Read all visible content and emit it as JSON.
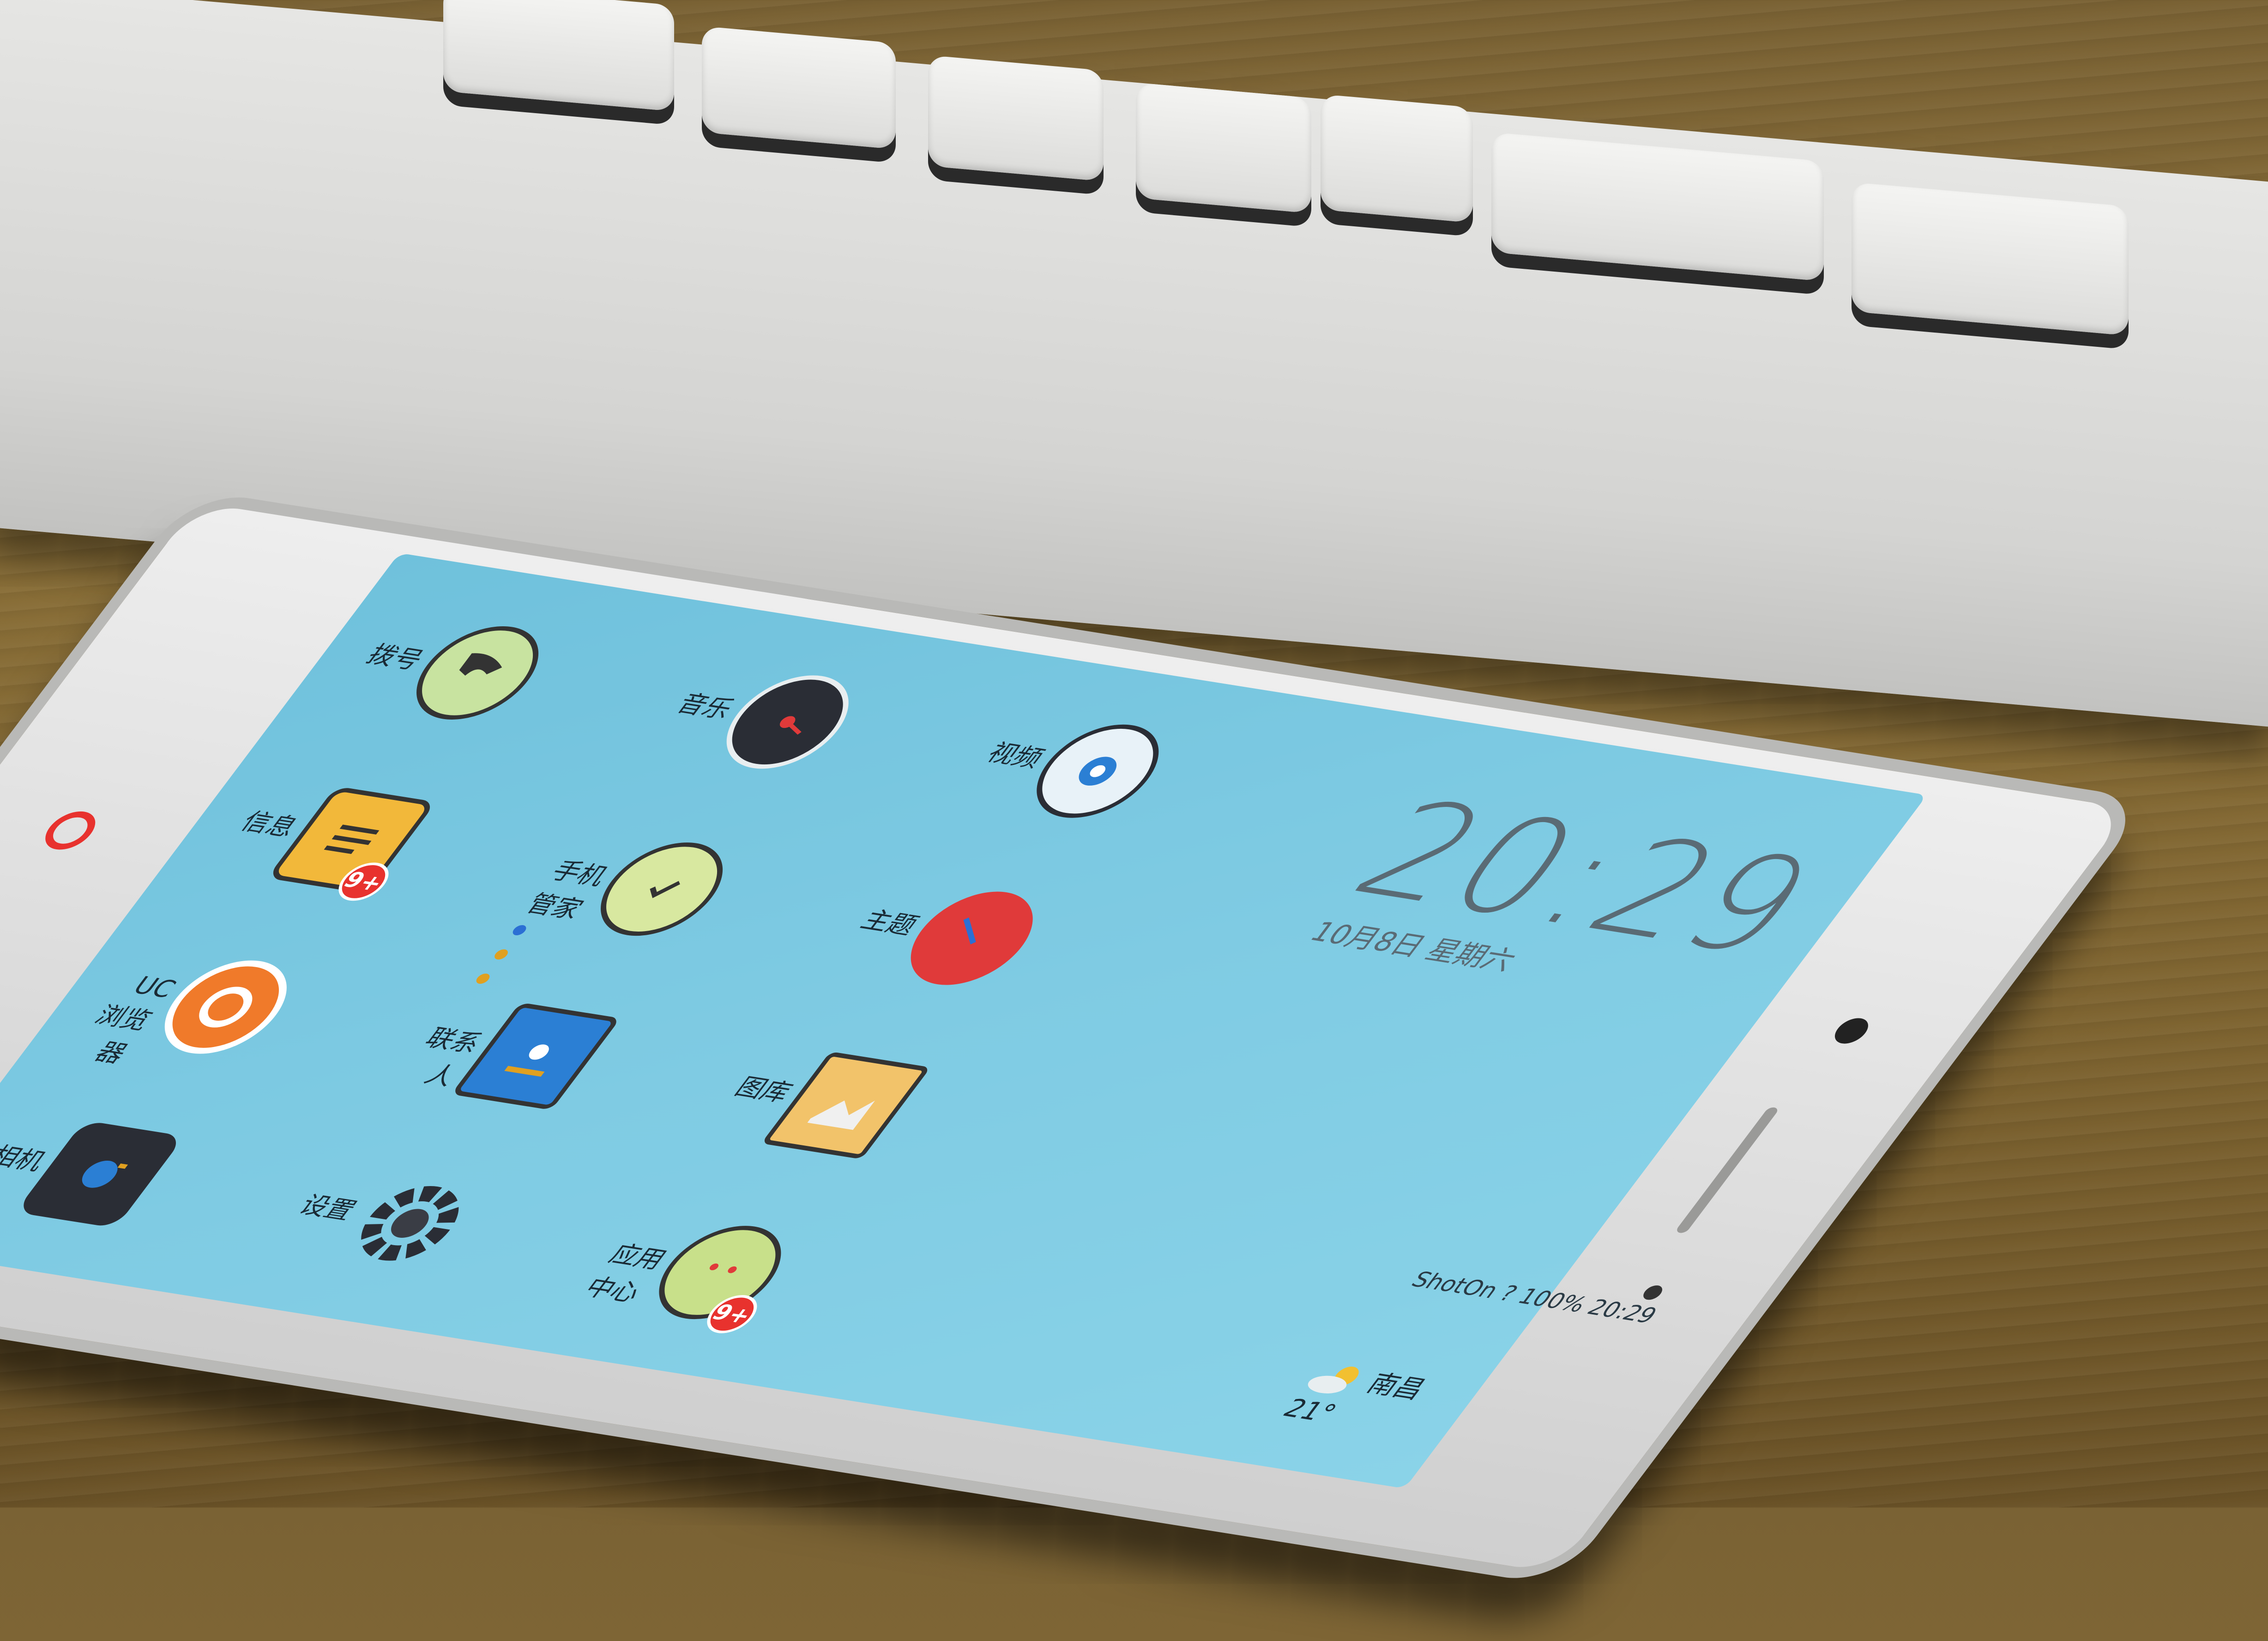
{
  "apps": [
    {
      "label": "拨号",
      "icon": "phone-dial-icon",
      "color": "#c8e3a0"
    },
    {
      "label": "音乐",
      "icon": "music-record-icon",
      "color": "#2a2d35"
    },
    {
      "label": "视频",
      "icon": "video-lens-icon",
      "color": "#e8f2f8"
    },
    {
      "label": "信息",
      "icon": "message-note-icon",
      "color": "#f2b83a",
      "badge": "9+"
    },
    {
      "label": "手机管家",
      "icon": "phone-manager-pill-icon",
      "color": "#d8e8a0"
    },
    {
      "label": "主题",
      "icon": "theme-heart-icon",
      "color": "#e03a3a"
    },
    {
      "label": "UC浏览器",
      "icon": "uc-browser-icon",
      "color": "#f07a2a"
    },
    {
      "label": "联系人",
      "icon": "contacts-book-icon",
      "color": "#2b7fd4"
    },
    {
      "label": "图库",
      "icon": "gallery-photo-icon",
      "color": "#f2c36a"
    },
    {
      "label": "相机",
      "icon": "camera-icon",
      "color": "#2a2d35"
    },
    {
      "label": "设置",
      "icon": "settings-gear-icon",
      "color": "#2a2d35"
    },
    {
      "label": "应用中心",
      "icon": "app-center-face-icon",
      "color": "#c8e08a",
      "badge": "9+"
    }
  ],
  "clock": {
    "time": "20:29",
    "date": "10月8日 星期六"
  },
  "status": {
    "text": "ShotOn ?  100%  20:29"
  },
  "weather": {
    "city": "南昌",
    "temperature": "21°",
    "icon": "weather-sun-cloud-icon"
  },
  "colors": {
    "screen": "#7fcbe3",
    "home_ring": "#e8322e",
    "badge": "#e8322e"
  }
}
